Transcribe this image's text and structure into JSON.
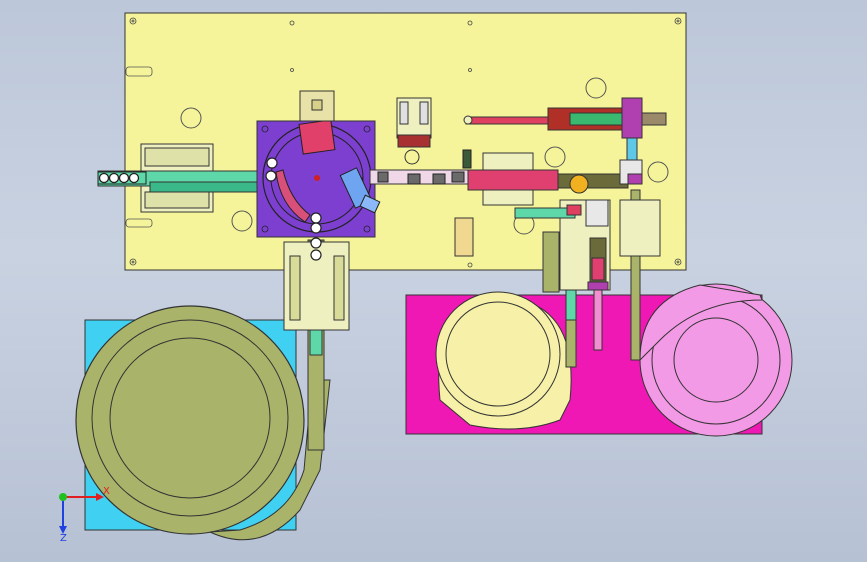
{
  "viewport": {
    "background_top": "#bcc7d9",
    "background_bottom": "#b6c1d4"
  },
  "colors": {
    "main_plate": "#f5f49a",
    "bowl_base_left": "#3fd0f2",
    "bowl_left": "#a9b46a",
    "bowl_base_right": "#f018b4",
    "bowl_right_yellow": "#f6f0a8",
    "bowl_right_pink": "#f39ae6",
    "rotary_base": "#7c3fd0",
    "rotary_disc": "#d8507a",
    "track_green": "#5ed8a8",
    "cylinder_red": "#e04060",
    "rail_purple": "#b040b0"
  },
  "triad": {
    "x_label": "X",
    "y_label": "Y",
    "z_label": "Z"
  }
}
